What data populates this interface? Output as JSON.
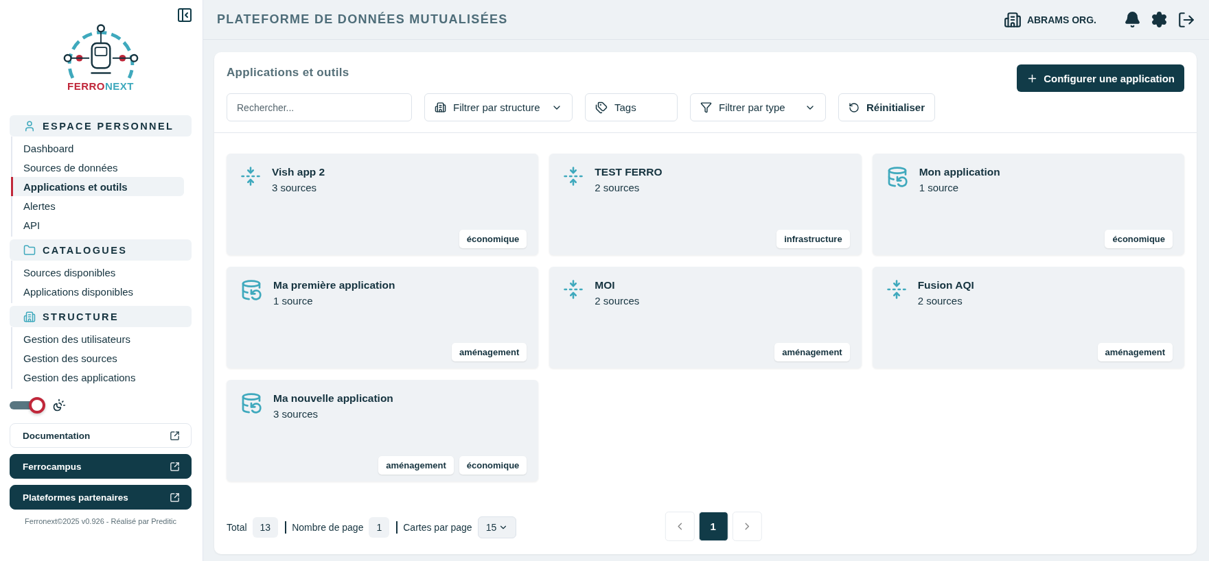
{
  "logo": {
    "word_1": "FERRO",
    "word_2": "NEXT"
  },
  "sidebar": {
    "sections": [
      {
        "title": "ESPACE PERSONNEL",
        "items": [
          {
            "label": "Dashboard",
            "selected": false
          },
          {
            "label": "Sources de données",
            "selected": false
          },
          {
            "label": "Applications et outils",
            "selected": true
          },
          {
            "label": "Alertes",
            "selected": false
          },
          {
            "label": "API",
            "selected": false
          }
        ]
      },
      {
        "title": "CATALOGUES",
        "items": [
          {
            "label": "Sources disponibles",
            "selected": false
          },
          {
            "label": "Applications disponibles",
            "selected": false
          }
        ]
      },
      {
        "title": "STRUCTURE",
        "items": [
          {
            "label": "Gestion des utilisateurs",
            "selected": false
          },
          {
            "label": "Gestion des sources",
            "selected": false
          },
          {
            "label": "Gestion des applications",
            "selected": false
          }
        ]
      }
    ],
    "theme_toggle": {
      "on": true
    },
    "links": [
      {
        "label": "Documentation",
        "kind": "outline"
      },
      {
        "label": "Ferrocampus",
        "kind": "dark"
      },
      {
        "label": "Plateformes partenaires",
        "kind": "dark"
      }
    ],
    "footer": "Ferronext©2025 v0.926 - Réalisé par Preditic"
  },
  "header": {
    "title": "PLATEFORME DE DONNÉES MUTUALISÉES",
    "organization": "ABRAMS ORG."
  },
  "panel": {
    "title": "Applications et outils",
    "action": "Configurer une application",
    "search": {
      "placeholder": "Rechercher..."
    },
    "filters": [
      {
        "label": "Filtrer par structure",
        "kind": "structure"
      },
      {
        "label": "Tags",
        "kind": "tags"
      },
      {
        "label": "Filtrer par type",
        "kind": "type"
      }
    ],
    "reset": "Réinitialiser",
    "cards": [
      {
        "name": "Vish app 2",
        "sources": "3 sources",
        "kind": "merge",
        "tags": [
          "économique"
        ]
      },
      {
        "name": "TEST FERRO",
        "sources": "2 sources",
        "kind": "merge",
        "tags": [
          "infrastructure"
        ]
      },
      {
        "name": "Mon application",
        "sources": "1 source",
        "kind": "database",
        "tags": [
          "économique"
        ]
      },
      {
        "name": "Ma première application",
        "sources": "1 source",
        "kind": "database",
        "tags": [
          "aménagement"
        ]
      },
      {
        "name": "MOI",
        "sources": "2 sources",
        "kind": "merge",
        "tags": [
          "aménagement"
        ]
      },
      {
        "name": "Fusion AQI",
        "sources": "2 sources",
        "kind": "merge",
        "tags": [
          "aménagement"
        ]
      },
      {
        "name": "Ma nouvelle application",
        "sources": "3 sources",
        "kind": "database",
        "tags": [
          "aménagement",
          "économique"
        ]
      }
    ],
    "pagination": {
      "total_label": "Total",
      "total": "13",
      "pages_label": "Nombre de page",
      "pages": "1",
      "per_page_label": "Cartes par page",
      "per_page": "15",
      "pages_list": [
        {
          "label": "1",
          "selected": true
        }
      ]
    }
  }
}
